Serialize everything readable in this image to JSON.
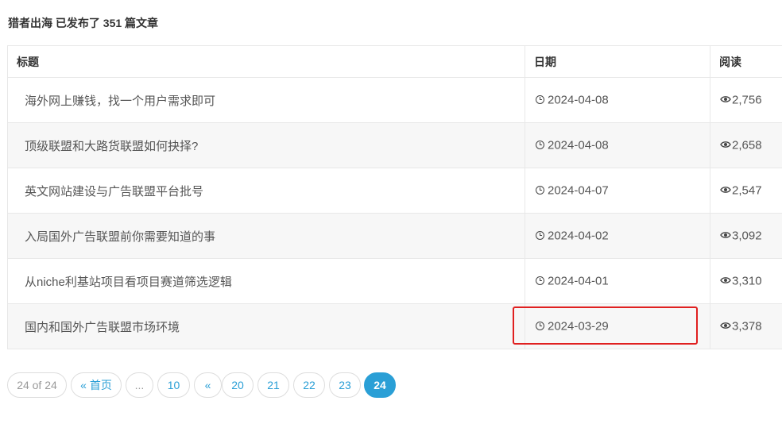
{
  "header": {
    "text": "猎者出海 已发布了 351 篇文章"
  },
  "table": {
    "columns": {
      "title": "标题",
      "date": "日期",
      "views": "阅读"
    },
    "rows": [
      {
        "title": "海外网上赚钱，找一个用户需求即可",
        "date": "2024-04-08",
        "views": "2,756"
      },
      {
        "title": "顶级联盟和大路货联盟如何抉择?",
        "date": "2024-04-08",
        "views": "2,658"
      },
      {
        "title": "英文网站建设与广告联盟平台批号",
        "date": "2024-04-07",
        "views": "2,547"
      },
      {
        "title": "入局国外广告联盟前你需要知道的事",
        "date": "2024-04-02",
        "views": "3,092"
      },
      {
        "title": "从niche利基站项目看项目赛道筛选逻辑",
        "date": "2024-04-01",
        "views": "3,310"
      },
      {
        "title": "国内和国外广告联盟市场环境",
        "date": "2024-03-29",
        "views": "3,378"
      }
    ],
    "highlighted_row_index": 5,
    "highlight_color": "#e02020"
  },
  "pagination": {
    "info": "24 of 24",
    "first": "« 首页",
    "ellipsis": "...",
    "prev_block": "«",
    "pages": [
      "10",
      "20",
      "21",
      "22",
      "23",
      "24"
    ],
    "current": "24",
    "accent_color": "#2a9fd6"
  },
  "icons": {
    "date": "clock-icon",
    "views": "eye-icon"
  }
}
